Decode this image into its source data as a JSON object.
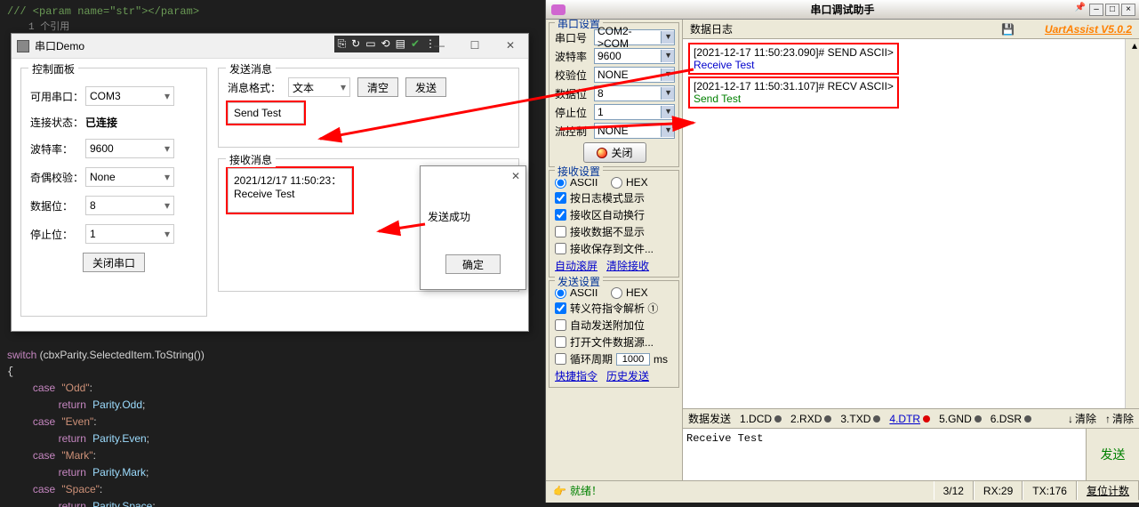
{
  "code": {
    "comment": "/// <param name=\"str\"></param>",
    "ref": "1 个引用",
    "switch": "switch (cbxParity.SelectedItem.ToString())",
    "cases": [
      {
        "c": "Odd",
        "r": "Parity.Odd"
      },
      {
        "c": "Even",
        "r": "Parity.Even"
      },
      {
        "c": "Mark",
        "r": "Parity.Mark"
      },
      {
        "c": "Space",
        "r": "Parity.Space"
      }
    ]
  },
  "demo": {
    "title": "串口Demo",
    "ctrl_title": "控制面板",
    "port_label": "可用串口：",
    "port_val": "COM3",
    "conn_label": "连接状态：",
    "conn_val": "已连接",
    "baud_label": "波特率：",
    "baud_val": "9600",
    "parity_label": "奇偶校验：",
    "parity_val": "None",
    "data_label": "数据位：",
    "data_val": "8",
    "stop_label": "停止位：",
    "stop_val": "1",
    "close_btn": "关闭串口",
    "send_title": "发送消息",
    "fmt_label": "消息格式：",
    "fmt_val": "文本",
    "clear_btn": "清空",
    "send_btn": "发送",
    "send_text": "Send Test",
    "recv_title": "接收消息",
    "recv_text1": "2021/12/17 11:50:23：",
    "recv_text2": "Receive Test"
  },
  "popup": {
    "msg": "发送成功",
    "ok": "确定"
  },
  "uart": {
    "title": "串口调试助手",
    "brand": "UartAssist V5.0.2",
    "port_grp": "串口设置",
    "port_no": "串口号",
    "port_no_v": "COM2->COM",
    "baud": "波特率",
    "baud_v": "9600",
    "chk": "校验位",
    "chk_v": "NONE",
    "data": "数据位",
    "data_v": "8",
    "stop": "停止位",
    "stop_v": "1",
    "flow": "流控制",
    "flow_v": "NONE",
    "close": "关闭",
    "recv_grp": "接收设置",
    "ascii": "ASCII",
    "hex": "HEX",
    "log_mode": "按日志模式显示",
    "auto_wrap": "接收区自动换行",
    "hide_recv": "接收数据不显示",
    "save_file": "接收保存到文件...",
    "auto_scroll": "自动滚屏",
    "clear_recv": "清除接收",
    "send_grp": "发送设置",
    "esc": "转义符指令解析 ①",
    "auto_append": "自动发送附加位",
    "open_file": "打开文件数据源...",
    "cycle": "循环周期",
    "cycle_v": "1000",
    "ms": "ms",
    "shortcut": "快捷指令",
    "history": "历史发送",
    "log_title": "数据日志",
    "log1_ts": "[2021-12-17 11:50:23.090]# SEND ASCII>",
    "log1_body": "Receive Test",
    "log2_ts": "[2021-12-17 11:50:31.107]# RECV ASCII>",
    "log2_body": "Send Test",
    "sendbar": "数据发送",
    "sig1": "1.DCD",
    "sig2": "2.RXD",
    "sig3": "3.TXD",
    "sig4": "4.DTR",
    "sig5": "5.GND",
    "sig6": "6.DSR",
    "clear": "清除",
    "send_txt": "Receive Test",
    "big_send": "发送",
    "ready": "就绪！",
    "st1": "3/12",
    "st2": "RX:29",
    "st3": "TX:176",
    "st4": "复位计数"
  }
}
